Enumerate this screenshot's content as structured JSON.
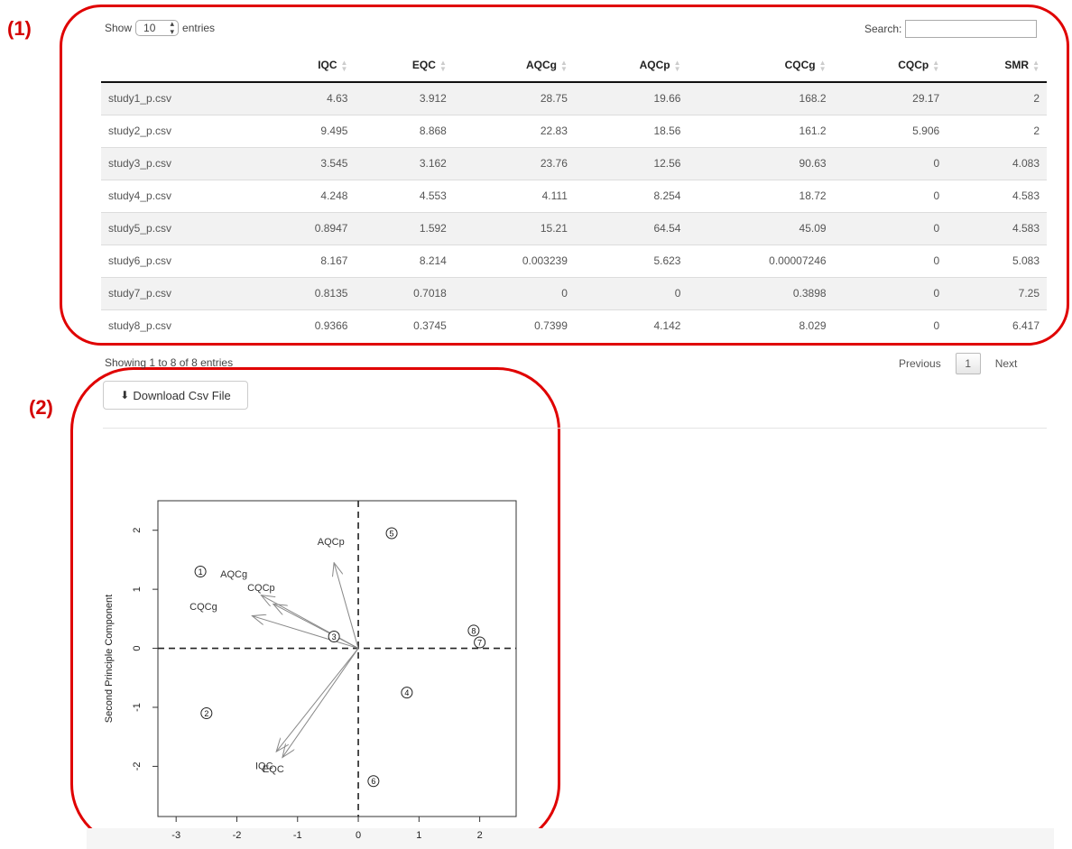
{
  "annotations": {
    "label1": "(1)",
    "label2": "(2)"
  },
  "length_menu": {
    "prefix": "Show",
    "value": "10",
    "suffix": "entries"
  },
  "search": {
    "label": "Search:",
    "value": ""
  },
  "table": {
    "columns": [
      "",
      "IQC",
      "EQC",
      "AQCg",
      "AQCp",
      "CQCg",
      "CQCp",
      "SMR"
    ],
    "rows": [
      [
        "study1_p.csv",
        "4.63",
        "3.912",
        "28.75",
        "19.66",
        "168.2",
        "29.17",
        "2"
      ],
      [
        "study2_p.csv",
        "9.495",
        "8.868",
        "22.83",
        "18.56",
        "161.2",
        "5.906",
        "2"
      ],
      [
        "study3_p.csv",
        "3.545",
        "3.162",
        "23.76",
        "12.56",
        "90.63",
        "0",
        "4.083"
      ],
      [
        "study4_p.csv",
        "4.248",
        "4.553",
        "4.111",
        "8.254",
        "18.72",
        "0",
        "4.583"
      ],
      [
        "study5_p.csv",
        "0.8947",
        "1.592",
        "15.21",
        "64.54",
        "45.09",
        "0",
        "4.583"
      ],
      [
        "study6_p.csv",
        "8.167",
        "8.214",
        "0.003239",
        "5.623",
        "0.00007246",
        "0",
        "5.083"
      ],
      [
        "study7_p.csv",
        "0.8135",
        "0.7018",
        "0",
        "0",
        "0.3898",
        "0",
        "7.25"
      ],
      [
        "study8_p.csv",
        "0.9366",
        "0.3745",
        "0.7399",
        "4.142",
        "8.029",
        "0",
        "6.417"
      ]
    ]
  },
  "info_text": "Showing 1 to 8 of 8 entries",
  "pagination": {
    "previous": "Previous",
    "current": "1",
    "next": "Next"
  },
  "download_button": {
    "label": "Download Csv File",
    "icon": "download-icon"
  },
  "chart_data": {
    "type": "scatter",
    "ylabel": "Second Principle Component",
    "xlim": [
      -3.3,
      2.6
    ],
    "ylim": [
      -2.85,
      2.5
    ],
    "xticks": [
      -3,
      -2,
      -1,
      0,
      1,
      2
    ],
    "yticks": [
      2,
      1,
      0,
      -1,
      -2
    ],
    "points": [
      {
        "label": "1",
        "x": -2.6,
        "y": 1.3
      },
      {
        "label": "2",
        "x": -2.5,
        "y": -1.1
      },
      {
        "label": "3",
        "x": -0.4,
        "y": 0.2
      },
      {
        "label": "4",
        "x": 0.8,
        "y": -0.75
      },
      {
        "label": "5",
        "x": 0.55,
        "y": 1.95
      },
      {
        "label": "6",
        "x": 0.25,
        "y": -2.25
      },
      {
        "label": "7",
        "x": 2.0,
        "y": 0.1
      },
      {
        "label": "8",
        "x": 1.9,
        "y": 0.3
      }
    ],
    "loadings": [
      {
        "name": "AQCp",
        "x": -0.4,
        "y": 1.45,
        "lx": -0.45,
        "ly": 1.75
      },
      {
        "name": "AQCg",
        "x": -1.6,
        "y": 0.9,
        "lx": -2.05,
        "ly": 1.2
      },
      {
        "name": "CQCp",
        "x": -1.4,
        "y": 0.75,
        "lx": -1.6,
        "ly": 0.97
      },
      {
        "name": "CQCg",
        "x": -1.75,
        "y": 0.55,
        "lx": -2.55,
        "ly": 0.65
      },
      {
        "name": "IQC",
        "x": -1.25,
        "y": -1.85,
        "lx": -1.55,
        "ly": -2.05
      },
      {
        "name": "EQC",
        "x": -1.35,
        "y": -1.75,
        "lx": -1.4,
        "ly": -2.1
      }
    ]
  }
}
